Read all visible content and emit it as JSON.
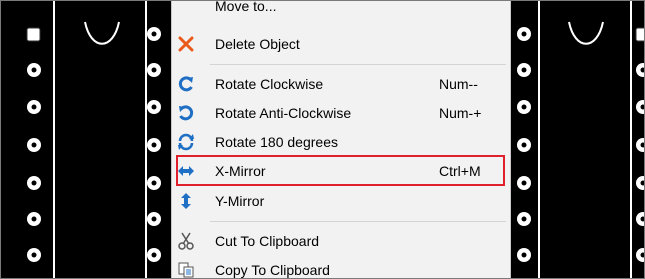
{
  "menu": {
    "items": [
      {
        "label": "Move to...",
        "shortcut": "",
        "icon": "move-icon"
      },
      {
        "label": "Delete Object",
        "shortcut": "",
        "icon": "delete-x-icon"
      },
      {
        "label": "Rotate Clockwise",
        "shortcut": "Num--",
        "icon": "rotate-clockwise-icon"
      },
      {
        "label": "Rotate Anti-Clockwise",
        "shortcut": "Num-+",
        "icon": "rotate-anticlockwise-icon"
      },
      {
        "label": "Rotate 180 degrees",
        "shortcut": "",
        "icon": "rotate-180-icon"
      },
      {
        "label": "X-Mirror",
        "shortcut": "Ctrl+M",
        "icon": "x-mirror-icon"
      },
      {
        "label": "Y-Mirror",
        "shortcut": "",
        "icon": "y-mirror-icon"
      },
      {
        "label": "Cut To Clipboard",
        "shortcut": "",
        "icon": "scissors-icon"
      },
      {
        "label": "Copy To Clipboard",
        "shortcut": "",
        "icon": "copy-icon"
      }
    ],
    "highlighted_item": "X-Mirror"
  },
  "colors": {
    "canvas": "#000000",
    "pad": "#ffffff",
    "menu_background": "#f2f2f2",
    "highlight_border": "#e0202c",
    "delete_icon": "#e8591a",
    "rotate_icon": "#1f6fc5"
  }
}
